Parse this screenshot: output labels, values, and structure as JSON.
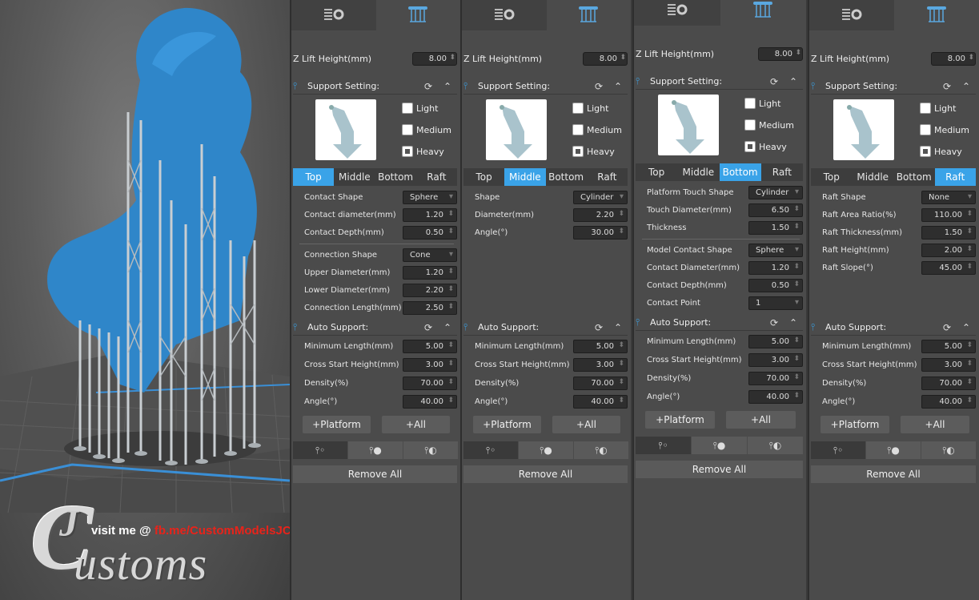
{
  "watermark": {
    "visit": "visit me @ ",
    "link": "fb.me/CustomModelsJC",
    "logo_letters": "JC",
    "logo_word": "ustoms"
  },
  "icons": {
    "settings_tab": "layers-gear-icon",
    "support_tab": "support-pillars-icon",
    "reset": "refresh-icon",
    "collapse": "chevron-up-icon"
  },
  "colors": {
    "accent": "#3aa3e8",
    "model": "#2f86c9"
  },
  "panels": [
    {
      "z_label": "Z Lift Height(mm)",
      "z_value": "8.00",
      "support_title": "Support Setting:",
      "density": [
        {
          "label": "Light"
        },
        {
          "label": "Medium"
        },
        {
          "label": "Heavy"
        }
      ],
      "subtabs": [
        "Top",
        "Middle",
        "Bottom",
        "Raft"
      ],
      "active": 0,
      "fields": [
        {
          "label": "Contact Shape",
          "value": "Sphere",
          "kind": "drop"
        },
        {
          "label": "Contact diameter(mm)",
          "value": "1.20",
          "kind": "spin"
        },
        {
          "label": "Contact Depth(mm)",
          "value": "0.50",
          "kind": "spin"
        },
        {
          "label": "Connection Shape",
          "value": "Cone",
          "kind": "drop",
          "divider": true
        },
        {
          "label": "Upper Diameter(mm)",
          "value": "1.20",
          "kind": "spin"
        },
        {
          "label": "Lower Diameter(mm)",
          "value": "2.20",
          "kind": "spin"
        },
        {
          "label": "Connection Length(mm)",
          "value": "2.50",
          "kind": "spin"
        }
      ],
      "auto_title": "Auto Support:",
      "auto": [
        {
          "label": "Minimum Length(mm)",
          "value": "5.00"
        },
        {
          "label": "Cross Start Height(mm)",
          "value": "3.00"
        },
        {
          "label": "Density(%)",
          "value": "70.00"
        },
        {
          "label": "Angle(°)",
          "value": "40.00"
        }
      ],
      "platform": "+Platform",
      "all": "+All",
      "remove": "Remove All"
    },
    {
      "z_label": "Z Lift Height(mm)",
      "z_value": "8.00",
      "support_title": "Support Setting:",
      "density": [
        {
          "label": "Light"
        },
        {
          "label": "Medium"
        },
        {
          "label": "Heavy"
        }
      ],
      "subtabs": [
        "Top",
        "Middle",
        "Bottom",
        "Raft"
      ],
      "active": 1,
      "fields": [
        {
          "label": "Shape",
          "value": "Cylinder",
          "kind": "drop"
        },
        {
          "label": "Diameter(mm)",
          "value": "2.20",
          "kind": "spin"
        },
        {
          "label": "Angle(°)",
          "value": "30.00",
          "kind": "spin"
        }
      ],
      "auto_title": "Auto Support:",
      "auto": [
        {
          "label": "Minimum Length(mm)",
          "value": "5.00"
        },
        {
          "label": "Cross Start Height(mm)",
          "value": "3.00"
        },
        {
          "label": "Density(%)",
          "value": "70.00"
        },
        {
          "label": "Angle(°)",
          "value": "40.00"
        }
      ],
      "platform": "+Platform",
      "all": "+All",
      "remove": "Remove All"
    },
    {
      "z_label": "Z Lift Height(mm)",
      "z_value": "8.00",
      "support_title": "Support Setting:",
      "density": [
        {
          "label": "Light"
        },
        {
          "label": "Medium"
        },
        {
          "label": "Heavy"
        }
      ],
      "subtabs": [
        "Top",
        "Middle",
        "Bottom",
        "Raft"
      ],
      "active": 2,
      "fields": [
        {
          "label": "Platform Touch Shape",
          "value": "Cylinder",
          "kind": "drop"
        },
        {
          "label": "Touch Diameter(mm)",
          "value": "6.50",
          "kind": "spin"
        },
        {
          "label": "Thickness",
          "value": "1.50",
          "kind": "spin"
        },
        {
          "label": "Model Contact Shape",
          "value": "Sphere",
          "kind": "drop",
          "divider": true
        },
        {
          "label": "Contact Diameter(mm)",
          "value": "1.20",
          "kind": "spin"
        },
        {
          "label": "Contact Depth(mm)",
          "value": "0.50",
          "kind": "spin"
        },
        {
          "label": "Contact Point",
          "value": "1",
          "kind": "drop"
        }
      ],
      "auto_title": "Auto Support:",
      "auto": [
        {
          "label": "Minimum Length(mm)",
          "value": "5.00"
        },
        {
          "label": "Cross Start Height(mm)",
          "value": "3.00"
        },
        {
          "label": "Density(%)",
          "value": "70.00"
        },
        {
          "label": "Angle(°)",
          "value": "40.00"
        }
      ],
      "platform": "+Platform",
      "all": "+All",
      "remove": "Remove All"
    },
    {
      "z_label": "Z Lift Height(mm)",
      "z_value": "8.00",
      "support_title": "Support Setting:",
      "density": [
        {
          "label": "Light"
        },
        {
          "label": "Medium"
        },
        {
          "label": "Heavy"
        }
      ],
      "subtabs": [
        "Top",
        "Middle",
        "Bottom",
        "Raft"
      ],
      "active": 3,
      "fields": [
        {
          "label": "Raft Shape",
          "value": "None",
          "kind": "drop"
        },
        {
          "label": "Raft Area Ratio(%)",
          "value": "110.00",
          "kind": "spin"
        },
        {
          "label": "Raft Thickness(mm)",
          "value": "1.50",
          "kind": "spin"
        },
        {
          "label": "Raft Height(mm)",
          "value": "2.00",
          "kind": "spin"
        },
        {
          "label": "Raft Slope(°)",
          "value": "45.00",
          "kind": "spin"
        }
      ],
      "auto_title": "Auto Support:",
      "auto": [
        {
          "label": "Minimum Length(mm)",
          "value": "5.00"
        },
        {
          "label": "Cross Start Height(mm)",
          "value": "3.00"
        },
        {
          "label": "Density(%)",
          "value": "70.00"
        },
        {
          "label": "Angle(°)",
          "value": "40.00"
        }
      ],
      "platform": "+Platform",
      "all": "+All",
      "remove": "Remove All"
    }
  ]
}
